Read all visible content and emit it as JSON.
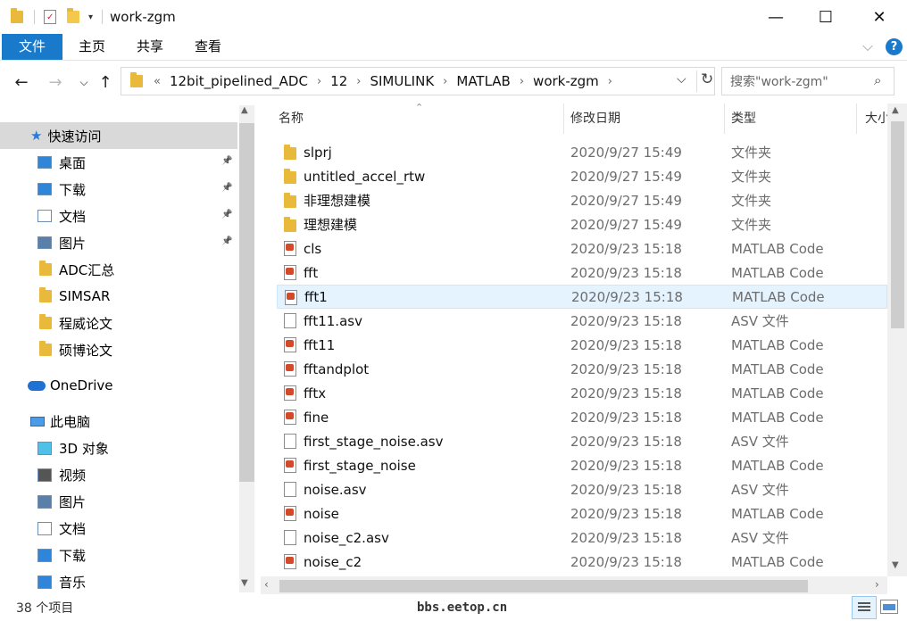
{
  "window": {
    "title": "work-zgm",
    "minimize_glyph": "—",
    "maximize_glyph": "☐",
    "close_glyph": "✕"
  },
  "ribbon": {
    "tabs": [
      "文件",
      "主页",
      "共享",
      "查看"
    ],
    "help_glyph": "?",
    "expand_glyph": "⌵"
  },
  "address": {
    "prefix": "«",
    "crumbs": [
      "12bit_pipelined_ADC",
      "12",
      "SIMULINK",
      "MATLAB",
      "work-zgm"
    ],
    "search_placeholder": "搜索\"work-zgm\""
  },
  "navpane": {
    "quick_access": "快速访问",
    "items": [
      {
        "label": "桌面",
        "icon": "desktop-icon",
        "pinned": true
      },
      {
        "label": "下载",
        "icon": "download-icon",
        "pinned": true
      },
      {
        "label": "文档",
        "icon": "documents-icon",
        "pinned": true
      },
      {
        "label": "图片",
        "icon": "pictures-icon",
        "pinned": true
      },
      {
        "label": "ADC汇总",
        "icon": "folder-icon",
        "pinned": false
      },
      {
        "label": "SIMSAR",
        "icon": "folder-icon",
        "pinned": false
      },
      {
        "label": "程威论文",
        "icon": "folder-icon",
        "pinned": false
      },
      {
        "label": "硕博论文",
        "icon": "folder-icon",
        "pinned": false
      }
    ],
    "onedrive": "OneDrive",
    "this_pc": "此电脑",
    "pc_items": [
      {
        "label": "3D 对象",
        "icon": "3d-objects-icon"
      },
      {
        "label": "视频",
        "icon": "videos-icon"
      },
      {
        "label": "图片",
        "icon": "pictures-icon"
      },
      {
        "label": "文档",
        "icon": "documents-icon"
      },
      {
        "label": "下载",
        "icon": "download-icon"
      },
      {
        "label": "音乐",
        "icon": "music-icon"
      }
    ]
  },
  "columns": {
    "name": "名称",
    "date": "修改日期",
    "type": "类型",
    "size": "大小"
  },
  "files": [
    {
      "name": "slprj",
      "date": "2020/9/27 15:49",
      "type": "文件夹",
      "kind": "folder"
    },
    {
      "name": "untitled_accel_rtw",
      "date": "2020/9/27 15:49",
      "type": "文件夹",
      "kind": "folder"
    },
    {
      "name": "非理想建模",
      "date": "2020/9/27 15:49",
      "type": "文件夹",
      "kind": "folder"
    },
    {
      "name": "理想建模",
      "date": "2020/9/27 15:49",
      "type": "文件夹",
      "kind": "folder"
    },
    {
      "name": "cls",
      "date": "2020/9/23 15:18",
      "type": "MATLAB Code",
      "kind": "m"
    },
    {
      "name": "fft",
      "date": "2020/9/23 15:18",
      "type": "MATLAB Code",
      "kind": "m"
    },
    {
      "name": "fft1",
      "date": "2020/9/23 15:18",
      "type": "MATLAB Code",
      "kind": "m",
      "selected": true
    },
    {
      "name": "fft11.asv",
      "date": "2020/9/23 15:18",
      "type": "ASV 文件",
      "kind": "asv"
    },
    {
      "name": "fft11",
      "date": "2020/9/23 15:18",
      "type": "MATLAB Code",
      "kind": "m"
    },
    {
      "name": "fftandplot",
      "date": "2020/9/23 15:18",
      "type": "MATLAB Code",
      "kind": "m"
    },
    {
      "name": "fftx",
      "date": "2020/9/23 15:18",
      "type": "MATLAB Code",
      "kind": "m"
    },
    {
      "name": "fine",
      "date": "2020/9/23 15:18",
      "type": "MATLAB Code",
      "kind": "m"
    },
    {
      "name": "first_stage_noise.asv",
      "date": "2020/9/23 15:18",
      "type": "ASV 文件",
      "kind": "asv"
    },
    {
      "name": "first_stage_noise",
      "date": "2020/9/23 15:18",
      "type": "MATLAB Code",
      "kind": "m"
    },
    {
      "name": "noise.asv",
      "date": "2020/9/23 15:18",
      "type": "ASV 文件",
      "kind": "asv"
    },
    {
      "name": "noise",
      "date": "2020/9/23 15:18",
      "type": "MATLAB Code",
      "kind": "m"
    },
    {
      "name": "noise_c2.asv",
      "date": "2020/9/23 15:18",
      "type": "ASV 文件",
      "kind": "asv"
    },
    {
      "name": "noise_c2",
      "date": "2020/9/23 15:18",
      "type": "MATLAB Code",
      "kind": "m"
    }
  ],
  "status": {
    "item_count": "38 个项目",
    "watermark": "bbs.eetop.cn"
  },
  "colors": {
    "accent": "#1979ca",
    "selection": "#e5f3ff",
    "folder": "#e8b93b"
  }
}
